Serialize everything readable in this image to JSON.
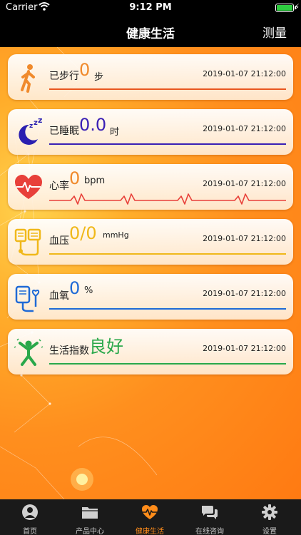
{
  "status_bar": {
    "carrier": "Carrier",
    "time": "9:12 PM"
  },
  "nav": {
    "title": "健康生活",
    "right_action": "测量"
  },
  "cards": [
    {
      "icon": "walking-person-icon",
      "label": "已步行",
      "value": "0",
      "unit": "步",
      "timestamp": "2019-01-07 21:12:00",
      "accent": "#e8561f",
      "value_color": "#f08a2c"
    },
    {
      "icon": "sleep-moon-icon",
      "label": "已睡眠",
      "value": "0.0",
      "unit": "时",
      "timestamp": "2019-01-07 21:12:00",
      "accent": "#3a1fb5",
      "value_color": "#3a1fb5"
    },
    {
      "icon": "heart-rate-icon",
      "label": "心率",
      "value": "0",
      "unit": "bpm",
      "timestamp": "2019-01-07 21:12:00",
      "accent": "#e8403a",
      "value_color": "#f08a2c"
    },
    {
      "icon": "blood-pressure-icon",
      "label": "血压",
      "value": "0/0",
      "unit": "mmHg",
      "timestamp": "2019-01-07 21:12:00",
      "accent": "#f0b81a",
      "value_color": "#f0b81a"
    },
    {
      "icon": "blood-oxygen-icon",
      "label": "血氧",
      "value": "0",
      "unit": "%",
      "timestamp": "2019-01-07 21:12:00",
      "accent": "#1f6ad6",
      "value_color": "#1f6ad6"
    },
    {
      "icon": "life-index-icon",
      "label": "生活指数",
      "value": "良好",
      "unit": "",
      "timestamp": "2019-01-07 21:12:00",
      "accent": "#2aa84a",
      "value_color": "#2aa84a"
    }
  ],
  "tabs": [
    {
      "icon": "profile-icon",
      "label": "首页",
      "active": false
    },
    {
      "icon": "folder-icon",
      "label": "产品中心",
      "active": false
    },
    {
      "icon": "heart-pulse-icon",
      "label": "健康生活",
      "active": true
    },
    {
      "icon": "chat-bubbles-icon",
      "label": "在线咨询",
      "active": false
    },
    {
      "icon": "gear-icon",
      "label": "设置",
      "active": false
    }
  ],
  "colors": {
    "active_tab": "#ff8c1a",
    "inactive_tab": "#c8c8c8",
    "background": "#ff8f1e"
  }
}
